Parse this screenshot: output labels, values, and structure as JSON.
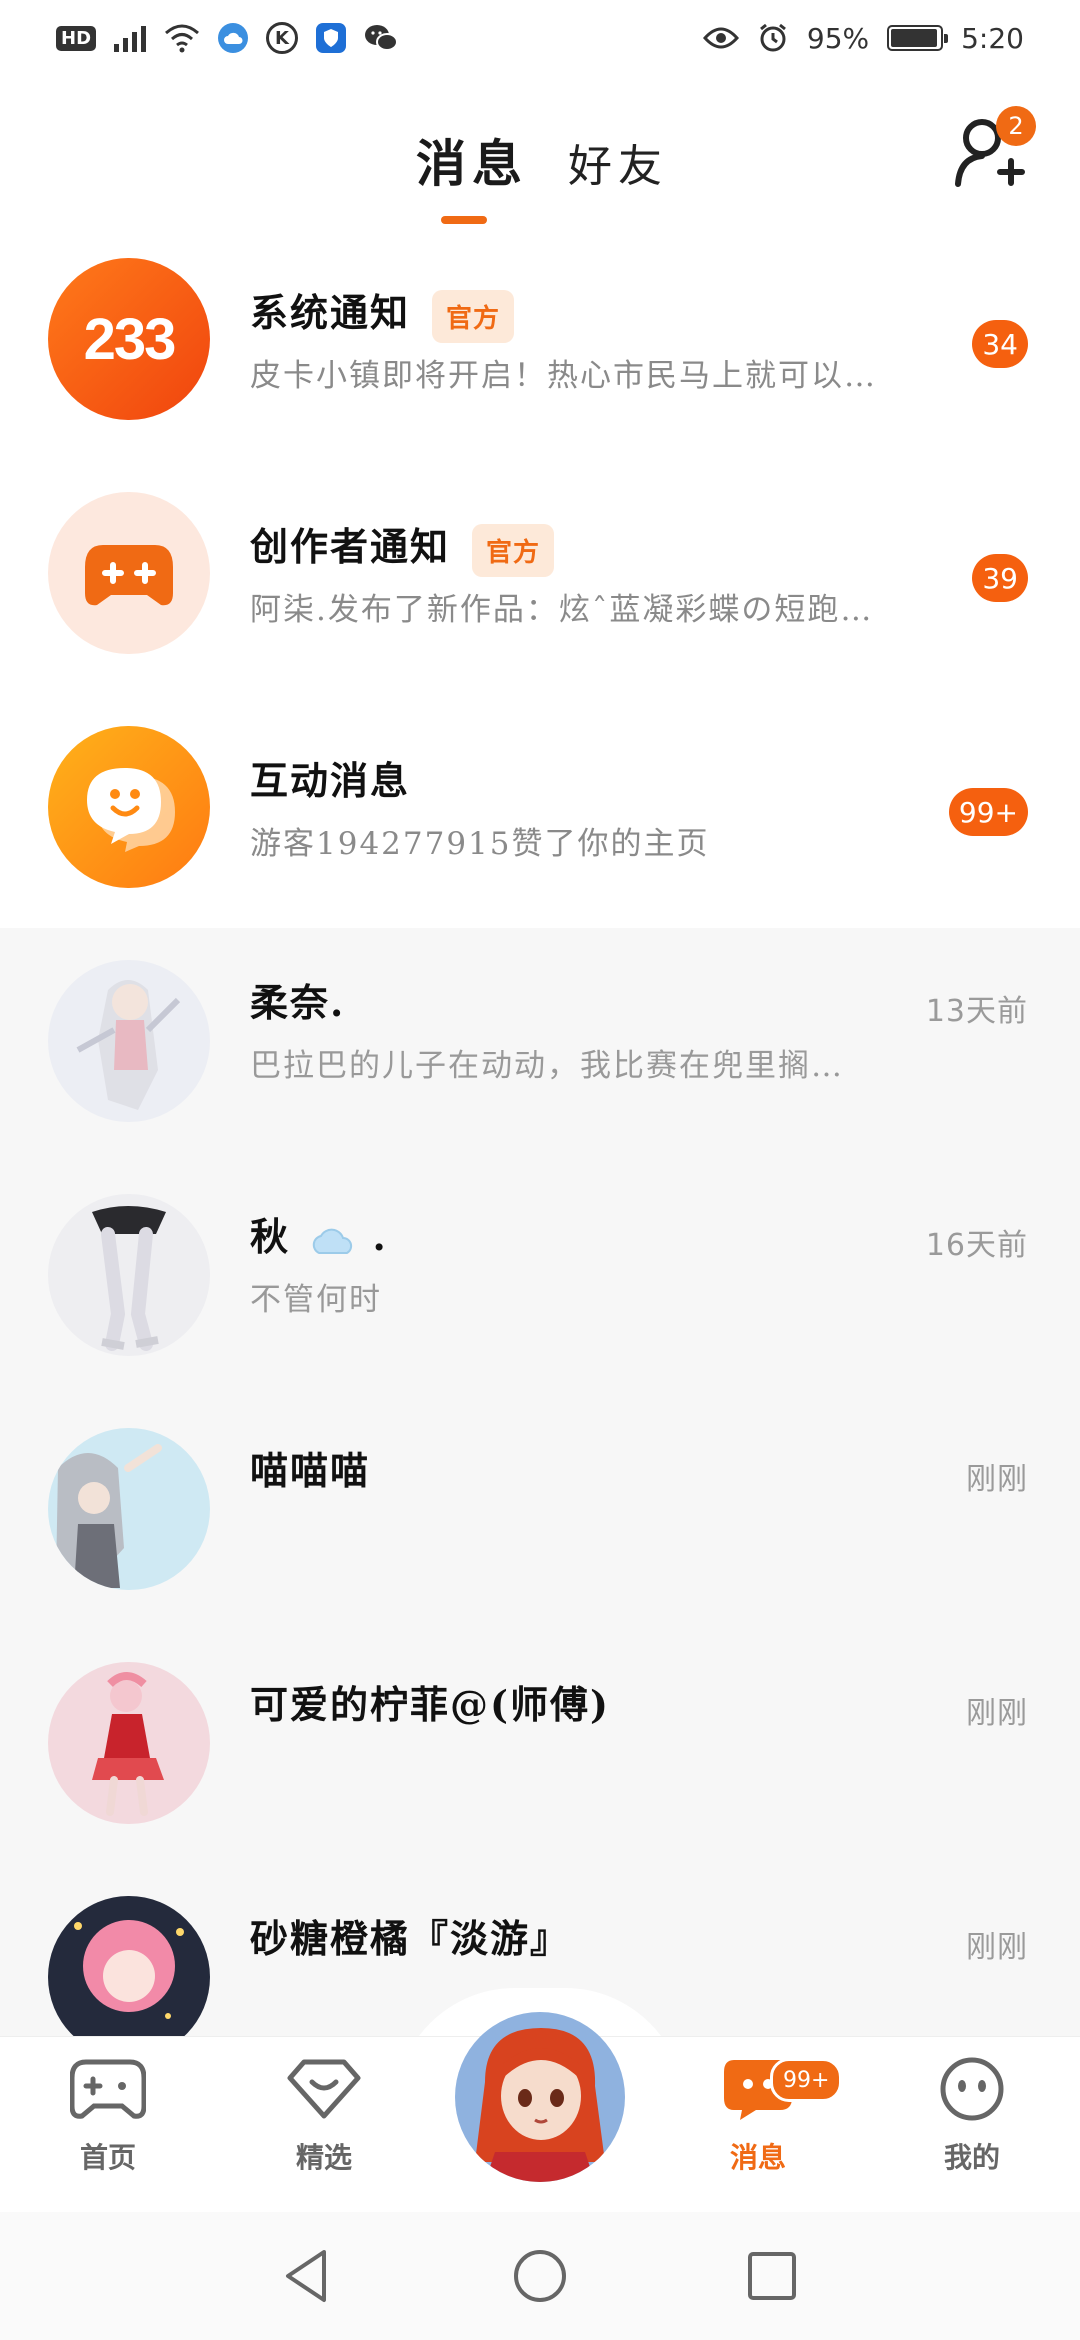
{
  "status_bar": {
    "hd": "HD",
    "battery_percent": "95%",
    "battery_level": 0.95,
    "time": "5:20",
    "k_icon_text": "K"
  },
  "header": {
    "tabs": [
      {
        "label": "消息",
        "active": true
      },
      {
        "label": "好友",
        "active": false
      }
    ],
    "add_friend_badge": "2"
  },
  "official_rows": [
    {
      "avatar_text": "233",
      "title": "系统通知",
      "tag": "官方",
      "subtitle": "皮卡小镇即将开启！热心市民马上就可以…",
      "count": "34"
    },
    {
      "title": "创作者通知",
      "tag": "官方",
      "subtitle": "阿柒.发布了新作品：炫ˆ蓝凝彩蝶の短跑…",
      "count": "39"
    },
    {
      "title": "互动消息",
      "subtitle": "游客194277915赞了你的主页",
      "count": "99+"
    }
  ],
  "chat_rows": [
    {
      "name": "柔奈.",
      "message": " 巴拉巴的儿子在动动，我比赛在兜里搁…",
      "time": "13天前"
    },
    {
      "name": "秋",
      "name_suffix": ".",
      "message": "不管何时",
      "time": "16天前"
    },
    {
      "name": "喵喵喵",
      "message": "",
      "time": "刚刚"
    },
    {
      "name": "可爱的柠菲@(师傅)",
      "message": "",
      "time": "刚刚"
    },
    {
      "name": "砂糖橙橘『淡游』",
      "message": "",
      "time": "刚刚"
    }
  ],
  "bottom_nav": {
    "items": [
      {
        "label": "首页",
        "icon": "gamepad-icon"
      },
      {
        "label": "精选",
        "icon": "heart-diamond-icon"
      },
      {
        "label": "消息",
        "icon": "message-icon",
        "active": true
      },
      {
        "label": "我的",
        "icon": "face-icon"
      }
    ],
    "message_badge": "99+"
  },
  "colors": {
    "accent": "#f06a14",
    "badge": "#f5600f",
    "background_list": "#f7f7f7"
  }
}
